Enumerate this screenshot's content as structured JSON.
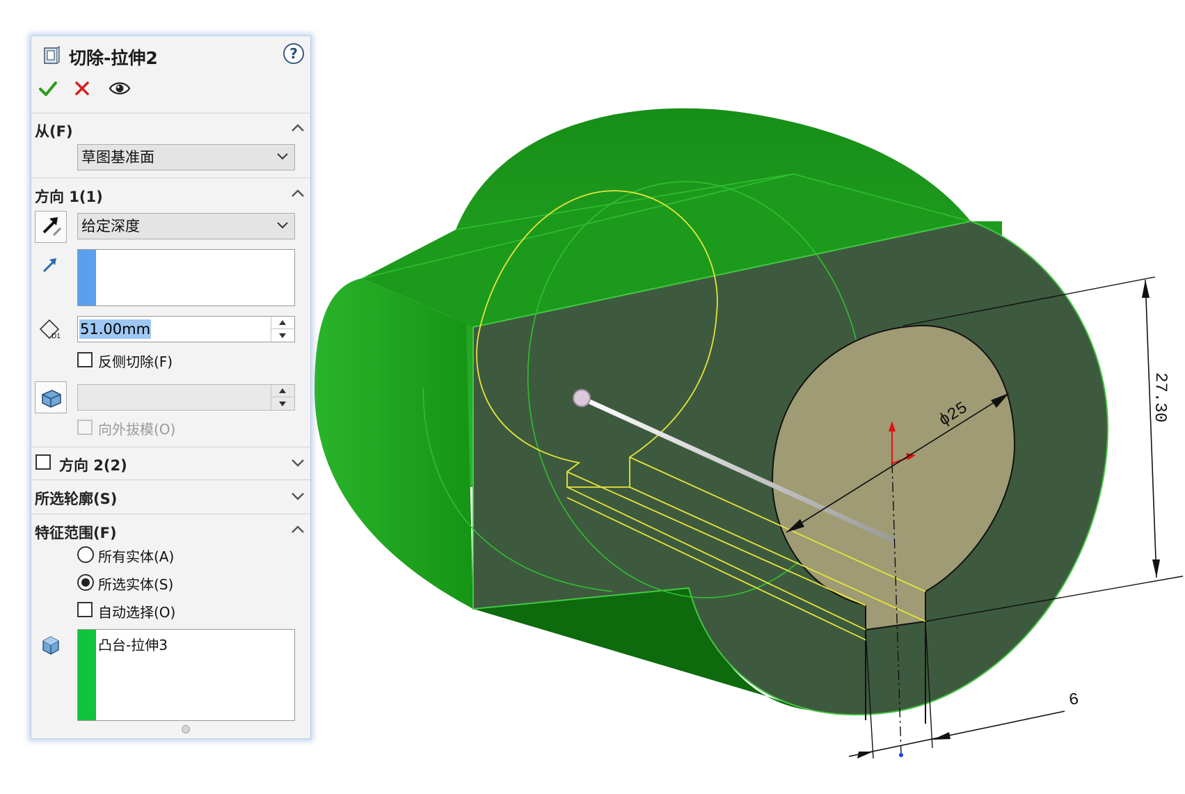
{
  "panel": {
    "title": "切除-拉伸2",
    "icons": {
      "feature": "cut-extrude-feature-icon",
      "help": "help-question-icon",
      "ok": "checkmark-icon",
      "cancel": "close-x-icon",
      "preview": "eye-preview-icon"
    },
    "help_glyph": "?",
    "from": {
      "title": "从(F)",
      "selected": "草图基准面"
    },
    "direction1": {
      "title": "方向 1(1)",
      "end_condition": "给定深度",
      "depth_value": "51.00mm",
      "depth_icon_label": "D1",
      "flip_side_label": "反侧切除(F)",
      "flip_side_checked": false,
      "draft_outward_label": "向外拔模(O)",
      "draft_outward_checked": false,
      "direction_strip_color": "#5aa0ef"
    },
    "direction2": {
      "title": "方向 2(2)",
      "checked": false
    },
    "selected_contours": {
      "title": "所选轮廓(S)"
    },
    "feature_scope": {
      "title": "特征范围(F)",
      "options": [
        {
          "label": "所有实体(A)",
          "selected": false
        },
        {
          "label": "所选实体(S)",
          "selected": true
        }
      ],
      "auto_select_label": "自动选择(O)",
      "auto_select_checked": false,
      "bodies": [
        "凸台-拉伸3"
      ],
      "bodies_strip_color": "#10c43b"
    }
  },
  "viewport": {
    "dimensions": {
      "diameter": "ϕ25",
      "height": "27.30",
      "width": "6"
    },
    "colors": {
      "body_green": "#1fa11f",
      "cut_face": "#3e5a3e",
      "hole_face": "#9f9b74",
      "sketch_yellow": "#e6e63a"
    }
  }
}
